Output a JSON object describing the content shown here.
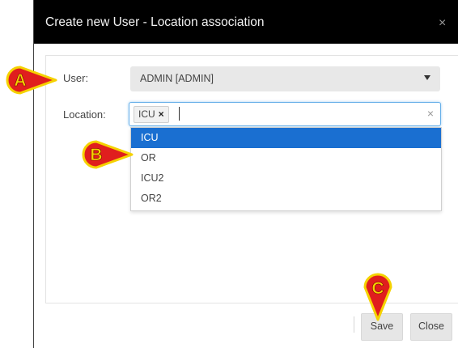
{
  "modal": {
    "title": "Create new User - Location association",
    "close_glyph": "×"
  },
  "form": {
    "user": {
      "label": "User:",
      "value": "ADMIN [ADMIN]"
    },
    "location": {
      "label": "Location:",
      "tags": [
        {
          "label": "ICU",
          "remove_glyph": "×"
        }
      ],
      "clear_glyph": "×",
      "options": [
        {
          "label": "ICU",
          "selected": true
        },
        {
          "label": "OR",
          "selected": false
        },
        {
          "label": "ICU2",
          "selected": false
        },
        {
          "label": "OR2",
          "selected": false
        }
      ]
    }
  },
  "footer": {
    "save_label": "Save",
    "close_label": "Close"
  },
  "callouts": [
    {
      "letter": "A"
    },
    {
      "letter": "B"
    },
    {
      "letter": "C"
    }
  ],
  "colors": {
    "header_bg": "#000000",
    "selected_option": "#1a6fd1",
    "callout_fill": "#e01e1e",
    "callout_ring": "#f5d200"
  }
}
